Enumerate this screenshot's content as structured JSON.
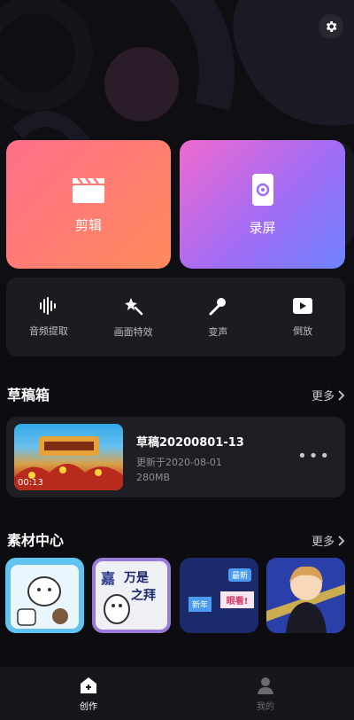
{
  "header": {
    "settings_icon": "gear-icon"
  },
  "main_actions": [
    {
      "label": "剪辑",
      "icon": "clapperboard-icon"
    },
    {
      "label": "录屏",
      "icon": "screen-record-icon"
    }
  ],
  "tools": [
    {
      "label": "音频提取",
      "icon": "audio-wave-icon"
    },
    {
      "label": "画面特效",
      "icon": "magic-wand-icon"
    },
    {
      "label": "变声",
      "icon": "microphone-icon"
    },
    {
      "label": "倒放",
      "icon": "play-reverse-icon"
    }
  ],
  "drafts": {
    "title": "草稿箱",
    "more_label": "更多",
    "item": {
      "name": "草稿20200801-13",
      "updated": "更新于2020-08-01",
      "size": "280MB",
      "duration": "00:13"
    }
  },
  "materials": {
    "title": "素材中心",
    "more_label": "更多",
    "tile2_texts": [
      "嘉",
      "万是",
      "之拜"
    ],
    "tile3_texts": [
      "最新",
      "新年",
      "眼看!"
    ]
  },
  "tabbar": {
    "items": [
      {
        "label": "创作",
        "active": true
      },
      {
        "label": "我的",
        "active": false
      }
    ]
  },
  "colors": {
    "background": "#0d0c10",
    "edit_card": "#ff7a78",
    "record_card": "#a26cf5",
    "panel": "#1c1b21"
  }
}
